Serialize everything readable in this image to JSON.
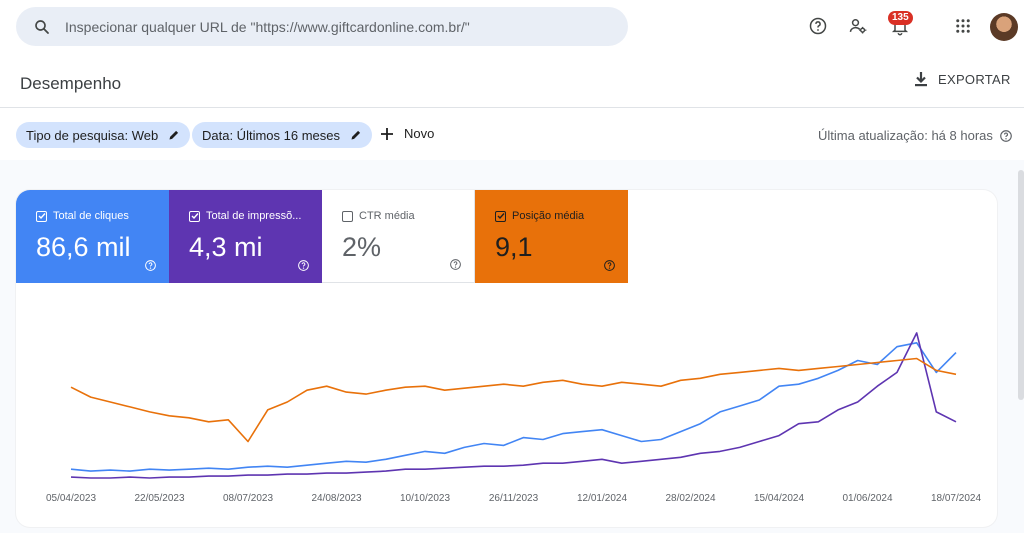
{
  "search": {
    "placeholder": "Inspecionar qualquer URL de \"https://www.giftcardonline.com.br/\""
  },
  "topbar": {
    "notifications_count": "135"
  },
  "page": {
    "title": "Desempenho",
    "export_label": "EXPORTAR"
  },
  "filters": {
    "chips": [
      "Tipo de pesquisa: Web",
      "Data: Últimos 16 meses"
    ],
    "new_label": "Novo",
    "last_update": "Última atualização: há 8 horas"
  },
  "metrics": [
    {
      "label": "Total de cliques",
      "value": "86,6 mil",
      "checked": true,
      "bg": "#4285f4",
      "fg": "#ffffff"
    },
    {
      "label": "Total de impressõ...",
      "value": "4,3 mi",
      "checked": true,
      "bg": "#5e35b1",
      "fg": "#ffffff"
    },
    {
      "label": "CTR média",
      "value": "2%",
      "checked": false,
      "bg": "#ffffff",
      "fg": "#5f6368"
    },
    {
      "label": "Posição média",
      "value": "9,1",
      "checked": true,
      "bg": "#e8710a",
      "fg": "#1f1f1f"
    }
  ],
  "chart_data": {
    "type": "line",
    "x_tick_labels": [
      "05/04/2023",
      "22/05/2023",
      "08/07/2023",
      "24/08/2023",
      "10/10/2023",
      "26/11/2023",
      "12/01/2024",
      "28/02/2024",
      "15/04/2024",
      "01/06/2024",
      "18/07/2024"
    ],
    "series": [
      {
        "name": "Total de cliques",
        "color": "#4285f4",
        "values": [
          12,
          10,
          11,
          10,
          12,
          11,
          12,
          13,
          12,
          14,
          15,
          14,
          16,
          18,
          20,
          19,
          22,
          26,
          30,
          28,
          34,
          38,
          36,
          44,
          42,
          48,
          50,
          52,
          46,
          40,
          42,
          50,
          58,
          70,
          76,
          82,
          96,
          98,
          104,
          112,
          122,
          118,
          136,
          140,
          110,
          130
        ]
      },
      {
        "name": "Total de impressões",
        "color": "#5e35b1",
        "values": [
          4,
          3,
          3,
          4,
          3,
          4,
          4,
          5,
          5,
          6,
          6,
          7,
          7,
          8,
          8,
          9,
          10,
          12,
          12,
          13,
          14,
          15,
          15,
          16,
          18,
          18,
          20,
          22,
          18,
          20,
          22,
          24,
          28,
          30,
          34,
          40,
          46,
          58,
          60,
          72,
          80,
          96,
          110,
          150,
          70,
          60
        ]
      },
      {
        "name": "Posição média",
        "color": "#e8710a",
        "values": [
          95,
          85,
          80,
          75,
          70,
          66,
          64,
          60,
          62,
          40,
          72,
          80,
          92,
          96,
          90,
          88,
          92,
          95,
          96,
          92,
          94,
          96,
          98,
          96,
          100,
          102,
          98,
          96,
          100,
          98,
          96,
          102,
          104,
          108,
          110,
          112,
          114,
          112,
          114,
          116,
          118,
          120,
          122,
          124,
          112,
          108
        ]
      }
    ]
  }
}
